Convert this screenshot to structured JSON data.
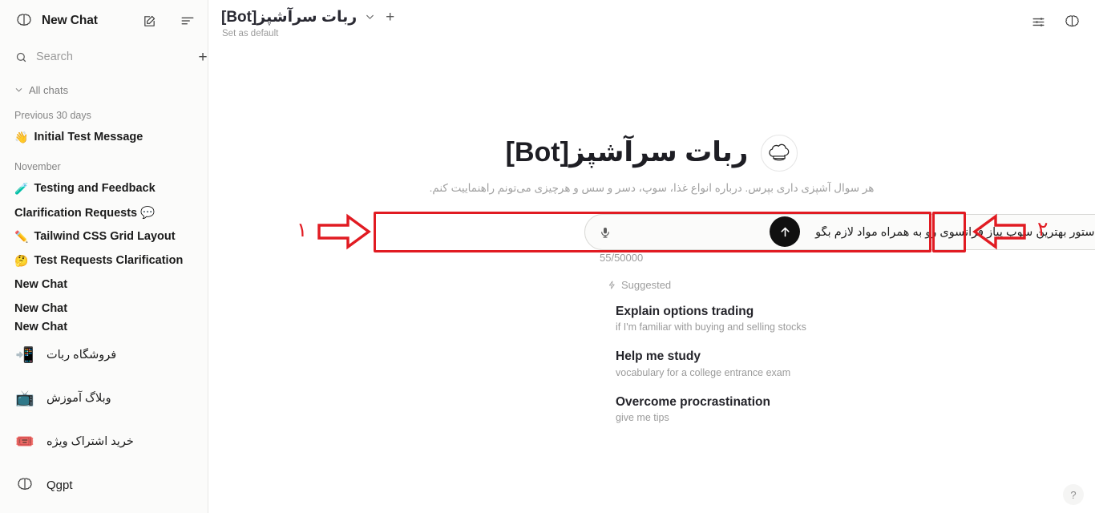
{
  "sidebar": {
    "logo_icon": "brain-logo-icon",
    "title": "New Chat",
    "compose_icon": "compose-icon",
    "menu_icon": "menu-lines-icon",
    "search": {
      "icon": "search-icon",
      "placeholder": "Search",
      "value": "",
      "add_icon": "plus-icon"
    },
    "all_chats_label": "All chats",
    "all_chats_chevron": "chevron-down-icon",
    "groups": [
      {
        "label": "Previous 30 days",
        "items": [
          {
            "emoji": "👋",
            "label": "Initial Test Message"
          }
        ]
      },
      {
        "label": "November",
        "items": [
          {
            "emoji": "🧪",
            "label": "Testing and Feedback"
          },
          {
            "emoji": "",
            "label": "Clarification Requests 💬"
          },
          {
            "emoji": "✏️",
            "label": "Tailwind CSS Grid Layout"
          },
          {
            "emoji": "🤔",
            "label": "Test Requests Clarification"
          },
          {
            "emoji": "",
            "label": "New Chat"
          },
          {
            "emoji": "",
            "label": "New Chat"
          },
          {
            "emoji": "",
            "label": "New Chat"
          }
        ]
      }
    ],
    "bottom_links": [
      {
        "icon": "📲",
        "icon_name": "robot-store-icon",
        "label": "فروشگاه ربات"
      },
      {
        "icon": "📺",
        "icon_name": "blog-icon",
        "label": "وبلاگ آموزش"
      },
      {
        "icon": "🎟️",
        "icon_name": "subscription-icon",
        "label": "خرید اشتراک ویژه"
      },
      {
        "icon": "",
        "icon_name": "brand-logo-icon",
        "label": "Qgpt"
      }
    ]
  },
  "topbar": {
    "bot_title": "ربات سرآشپز[Bot]",
    "chevron_icon": "chevron-down-icon",
    "plus_icon": "plus-icon",
    "set_default_label": "Set as default",
    "sliders_icon": "sliders-icon",
    "brand_icon": "brain-logo-icon"
  },
  "hero": {
    "avatar_icon": "chef-hat-icon",
    "title": "ربات سرآشپز[Bot]",
    "subtitle": "هر سوال آشپزی داری بپرس. درباره انواع غذا، سوپ، دسر و سس و هرچیزی می‌تونم راهنماییت کنم."
  },
  "composer": {
    "mic_icon": "microphone-icon",
    "value": "دستور بهترین سوپ پیاز فرانسوی رو به همراه مواد لازم بگو",
    "placeholder": "",
    "attach_icon": "plus-icon",
    "send_icon": "arrow-up-icon",
    "char_count": "55/50000"
  },
  "suggested": {
    "header_label": "Suggested",
    "header_icon": "lightning-bolt-icon",
    "items": [
      {
        "title": "Explain options trading",
        "desc": "if I'm familiar with buying and selling stocks"
      },
      {
        "title": "Help me study",
        "desc": "vocabulary for a college entrance exam"
      },
      {
        "title": "Overcome procrastination",
        "desc": "give me tips"
      }
    ]
  },
  "help": {
    "label": "?"
  },
  "annotations": {
    "color": "#e11b22",
    "marker_1": "۱",
    "marker_2": "۲"
  }
}
